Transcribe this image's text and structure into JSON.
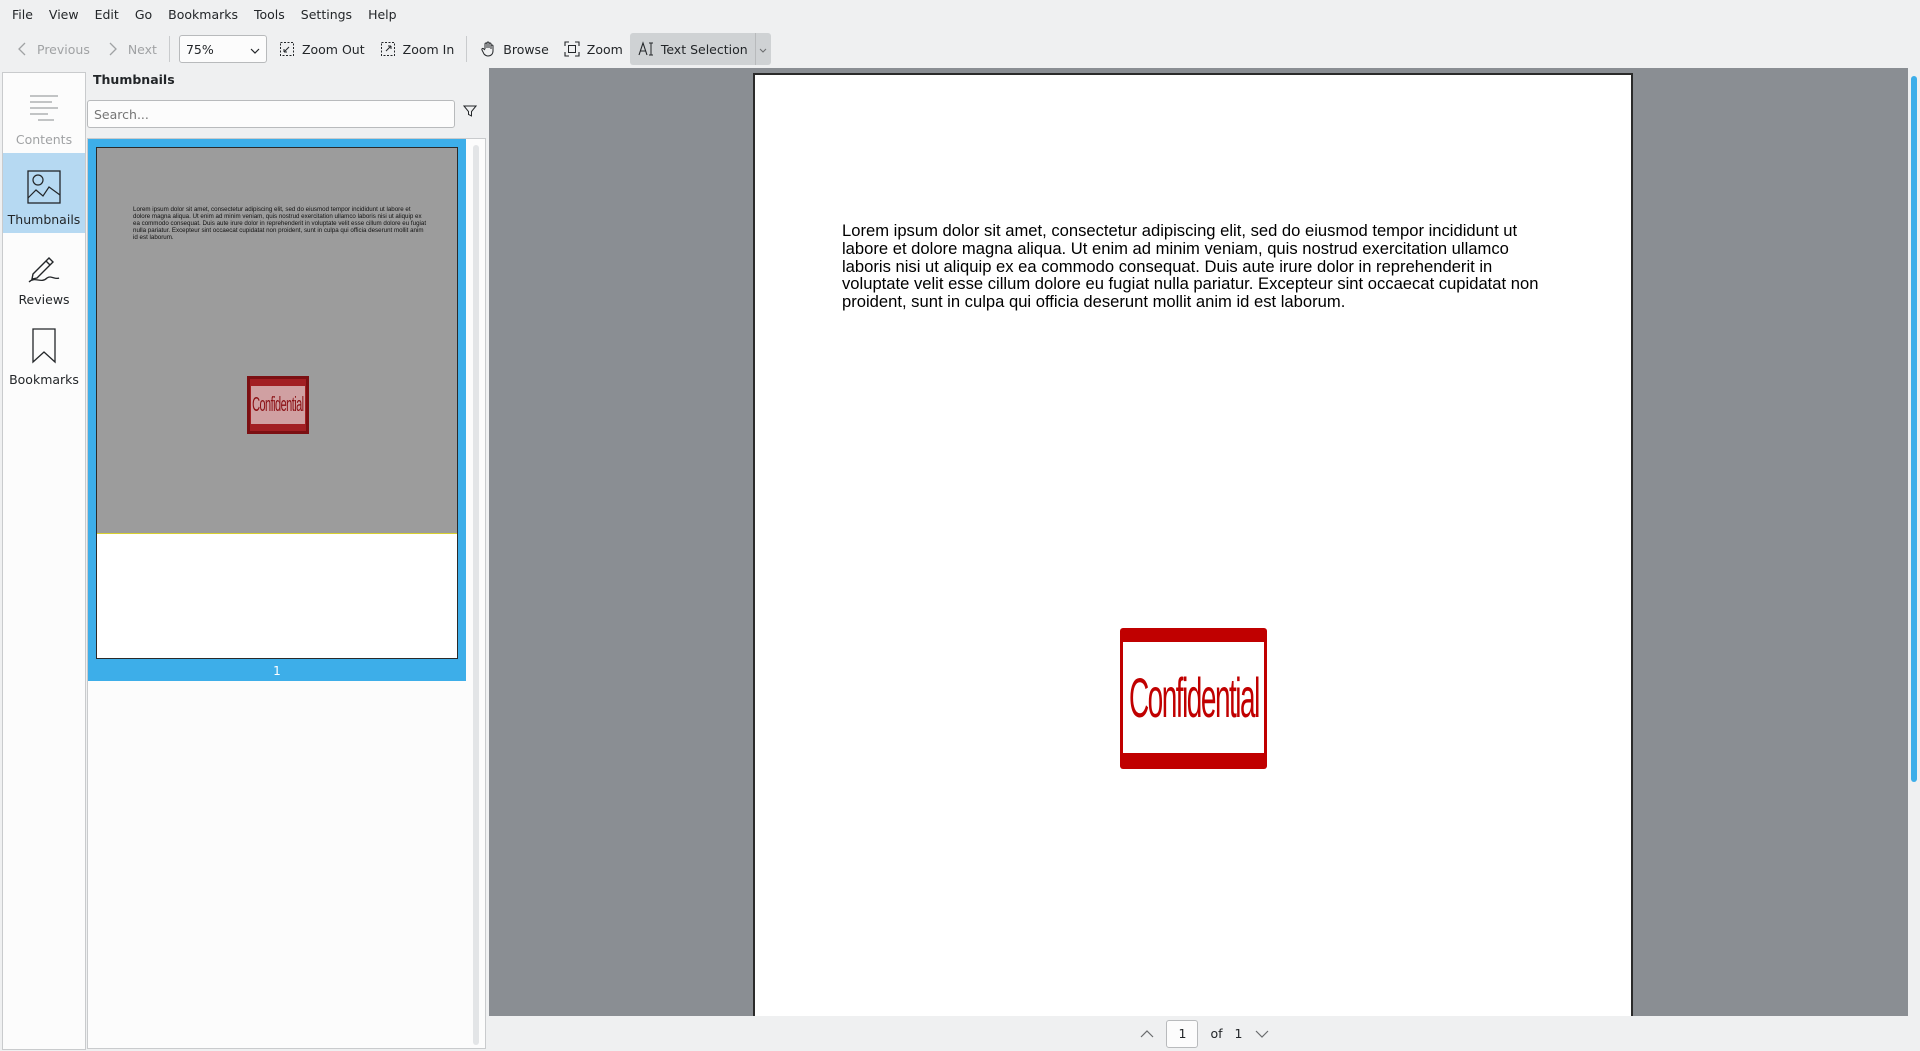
{
  "menubar": {
    "items": [
      "File",
      "View",
      "Edit",
      "Go",
      "Bookmarks",
      "Tools",
      "Settings",
      "Help"
    ]
  },
  "toolbar": {
    "previous_label": "Previous",
    "next_label": "Next",
    "zoom_value": "75%",
    "zoom_out_label": "Zoom Out",
    "zoom_in_label": "Zoom In",
    "browse_label": "Browse",
    "zoom_label": "Zoom",
    "text_selection_label": "Text Selection"
  },
  "sidebar": {
    "tabs": [
      {
        "label": "Contents",
        "icon": "contents-icon",
        "enabled": false,
        "selected": false
      },
      {
        "label": "Thumbnails",
        "icon": "thumbnails-icon",
        "enabled": true,
        "selected": true
      },
      {
        "label": "Reviews",
        "icon": "reviews-icon",
        "enabled": true,
        "selected": false
      },
      {
        "label": "Bookmarks",
        "icon": "bookmarks-icon",
        "enabled": true,
        "selected": false
      }
    ]
  },
  "thumbnails": {
    "title": "Thumbnails",
    "search_placeholder": "Search...",
    "items": [
      {
        "page_label": "1"
      }
    ]
  },
  "document": {
    "body_text": "Lorem ipsum dolor sit amet, consectetur adipiscing elit, sed do eiusmod tempor incididunt ut labore et dolore magna aliqua. Ut enim ad minim veniam, quis nostrud exercitation ullamco laboris nisi ut aliquip ex ea commodo consequat. Duis aute irure dolor in reprehenderit in voluptate velit esse cillum dolore eu fugiat nulla pariatur. Excepteur sint occaecat cupidatat non proident, sunt in culpa qui officia deserunt mollit anim id est laborum.",
    "stamp_text": "Confidential"
  },
  "pagebar": {
    "current_page": "1",
    "of_label": "of",
    "total_pages": "1"
  },
  "colors": {
    "accent": "#3daee9",
    "selected_tab": "#b6d9f2",
    "stamp_red": "#c00000",
    "view_background": "#8a8e93"
  }
}
